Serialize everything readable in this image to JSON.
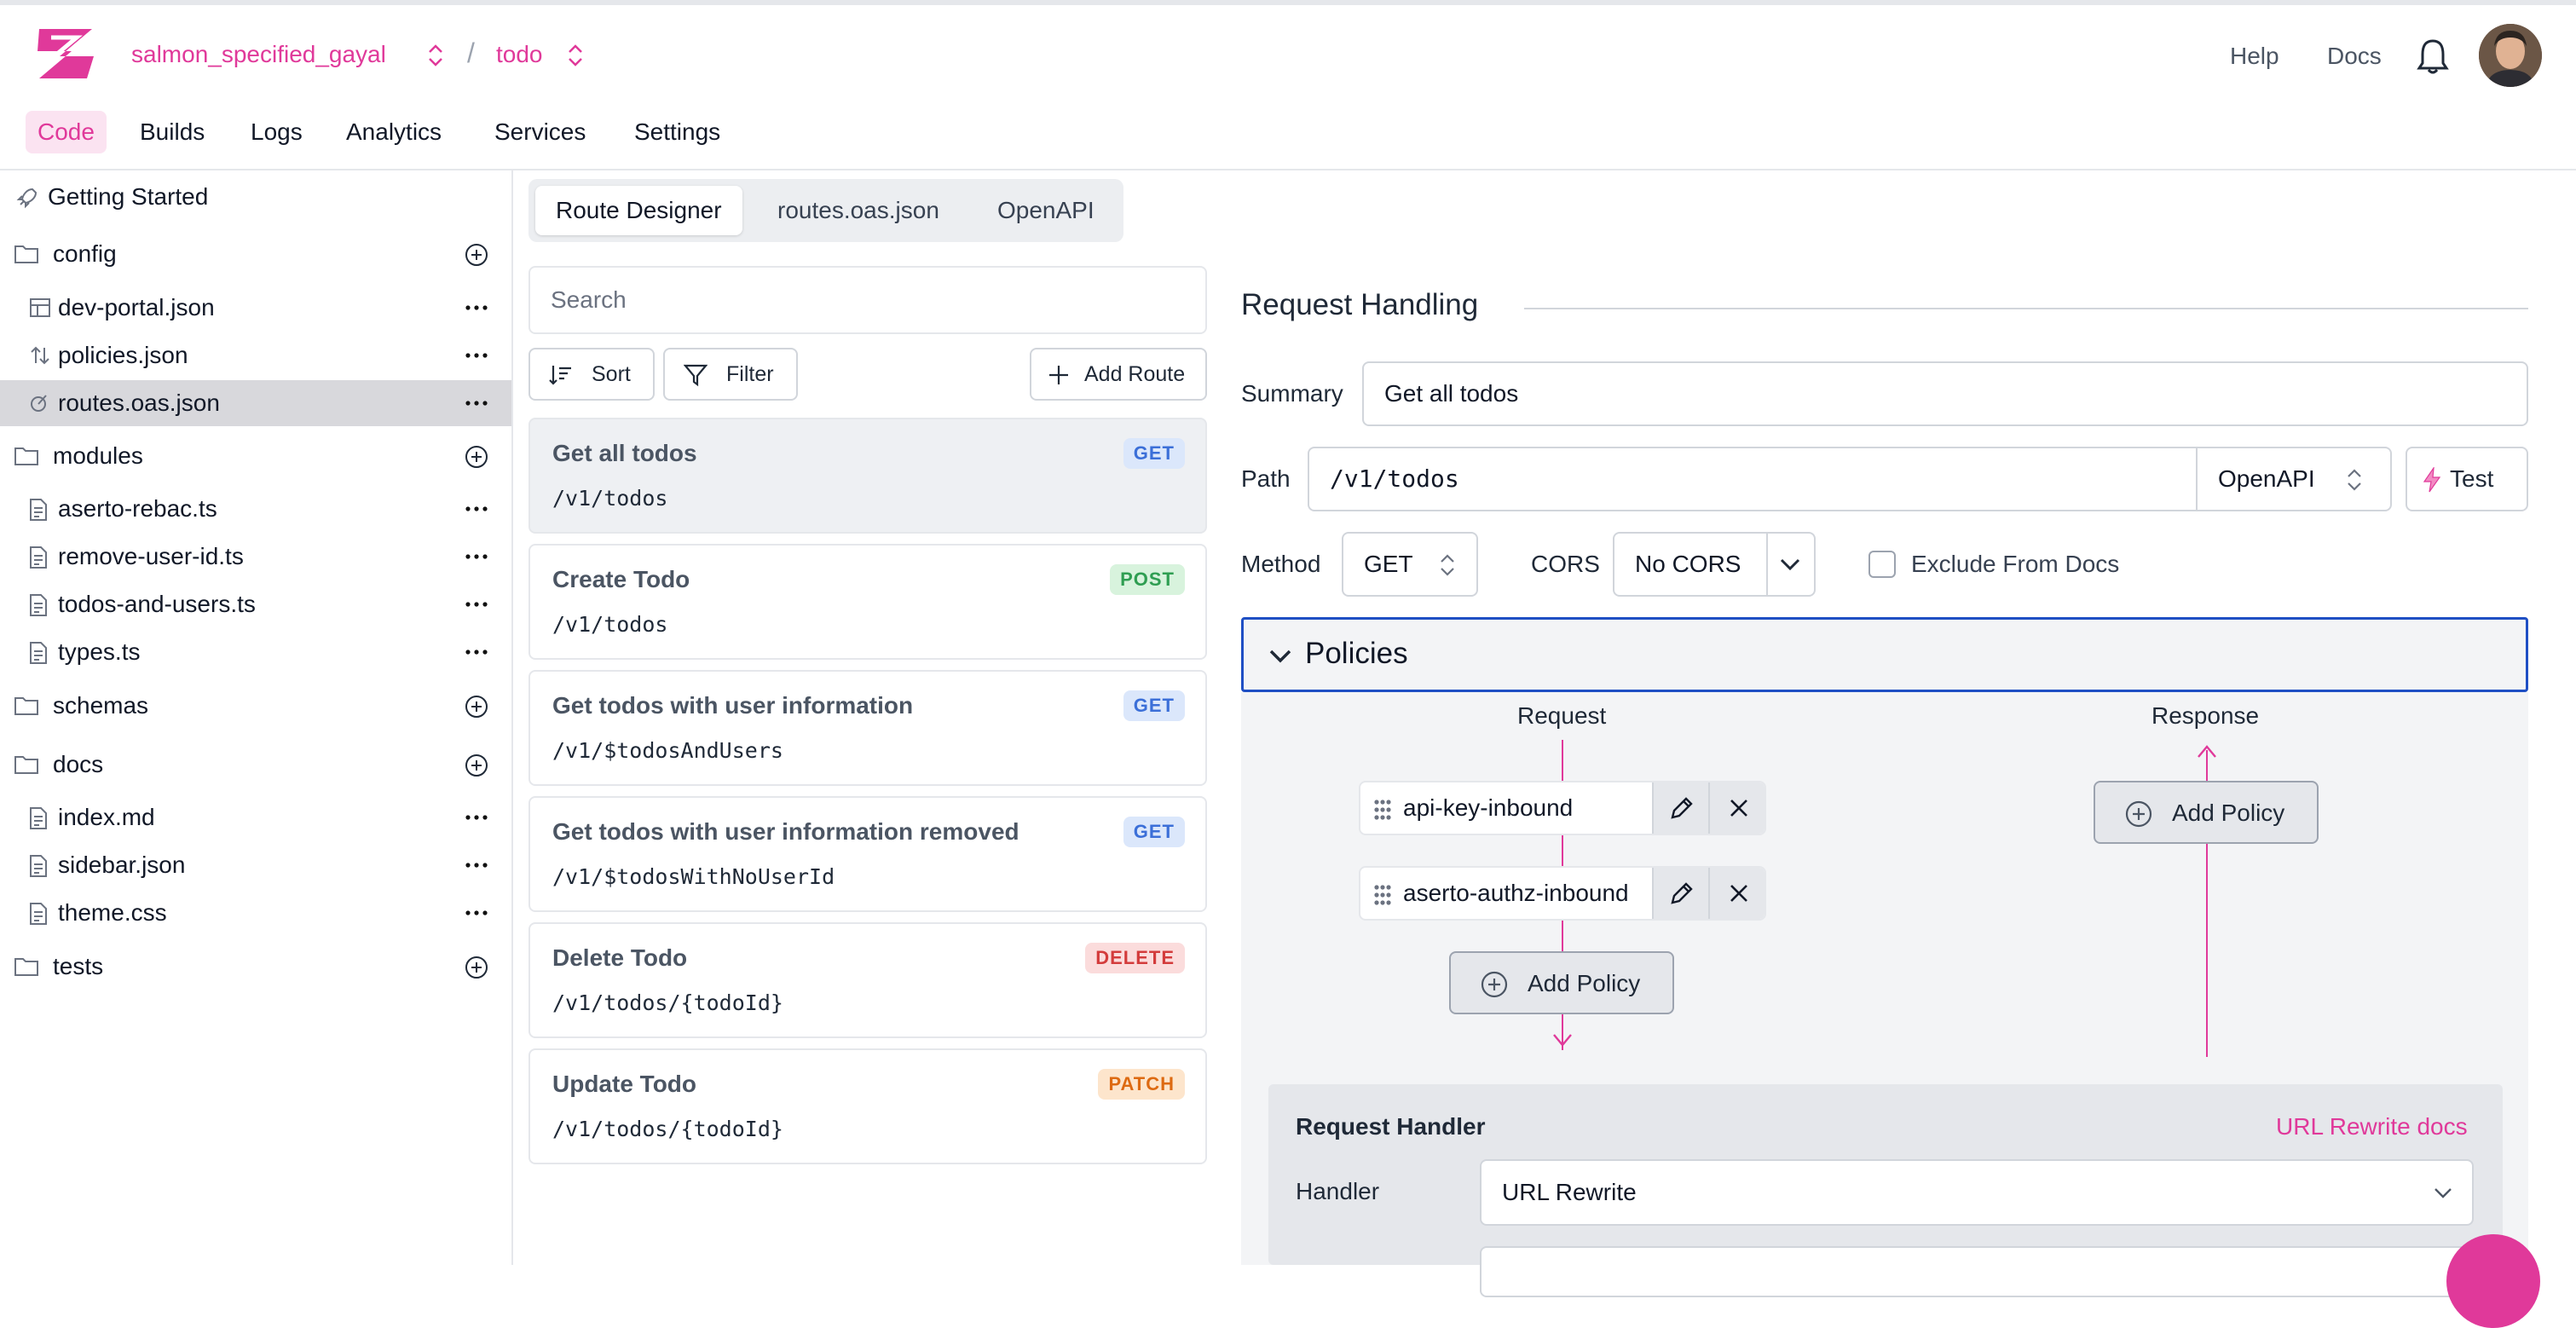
{
  "header": {
    "project": "salmon_specified_gayal",
    "separator": "/",
    "branch": "todo",
    "links": [
      "Help",
      "Docs"
    ]
  },
  "nav": {
    "items": [
      "Code",
      "Builds",
      "Logs",
      "Analytics",
      "Services",
      "Settings"
    ],
    "active": "Code"
  },
  "sidebar": {
    "getting_started": "Getting Started",
    "folders": {
      "config": "config",
      "modules": "modules",
      "schemas": "schemas",
      "docs": "docs",
      "tests": "tests"
    },
    "files": {
      "dev_portal": "dev-portal.json",
      "policies": "policies.json",
      "routes": "routes.oas.json",
      "aserto_rebac": "aserto-rebac.ts",
      "remove_user_id": "remove-user-id.ts",
      "todos_and_users": "todos-and-users.ts",
      "types": "types.ts",
      "index_md": "index.md",
      "sidebar_json": "sidebar.json",
      "theme_css": "theme.css"
    },
    "selected": "routes.oas.json"
  },
  "tabs": {
    "items": [
      "Route Designer",
      "routes.oas.json",
      "OpenAPI"
    ],
    "active": "Route Designer"
  },
  "routes_panel": {
    "search_placeholder": "Search",
    "sort_label": "Sort",
    "filter_label": "Filter",
    "add_route_label": "Add Route",
    "routes": [
      {
        "title": "Get all todos",
        "path": "/v1/todos",
        "method": "GET"
      },
      {
        "title": "Create Todo",
        "path": "/v1/todos",
        "method": "POST"
      },
      {
        "title": "Get todos with user information",
        "path": "/v1/$todosAndUsers",
        "method": "GET"
      },
      {
        "title": "Get todos with user information removed",
        "path": "/v1/$todosWithNoUserId",
        "method": "GET"
      },
      {
        "title": "Delete Todo",
        "path": "/v1/todos/{todoId}",
        "method": "DELETE"
      },
      {
        "title": "Update Todo",
        "path": "/v1/todos/{todoId}",
        "method": "PATCH"
      }
    ],
    "selected_index": 0
  },
  "request_handling": {
    "title": "Request Handling",
    "summary_label": "Summary",
    "summary_value": "Get all todos",
    "path_label": "Path",
    "path_value": "/v1/todos",
    "path_mode": "OpenAPI",
    "test_label": "Test",
    "method_label": "Method",
    "method_value": "GET",
    "cors_label": "CORS",
    "cors_value": "No CORS",
    "exclude_label": "Exclude From Docs",
    "exclude_checked": false
  },
  "policies": {
    "title": "Policies",
    "request_label": "Request",
    "response_label": "Response",
    "inbound": [
      "api-key-inbound",
      "aserto-authz-inbound"
    ],
    "add_policy_label": "Add Policy"
  },
  "request_handler": {
    "title": "Request Handler",
    "docs_link": "URL Rewrite docs",
    "handler_label": "Handler",
    "handler_value": "URL Rewrite"
  },
  "colors": {
    "brand": "#e0399a",
    "focus": "#1f4fc4",
    "get": "#3b6fd8",
    "post": "#2f9e52",
    "delete": "#d33b3b",
    "patch": "#dd6a12"
  },
  "icons": [
    "zuplo-logo-icon",
    "chevron-updown-icon",
    "bell-icon",
    "rocket-icon",
    "folder-icon",
    "plus-circle-icon",
    "file-icon",
    "more-icon",
    "sort-icon",
    "filter-icon",
    "plus-icon",
    "pencil-icon",
    "close-icon",
    "drag-handle-icon",
    "chevron-down-icon",
    "bolt-icon"
  ]
}
